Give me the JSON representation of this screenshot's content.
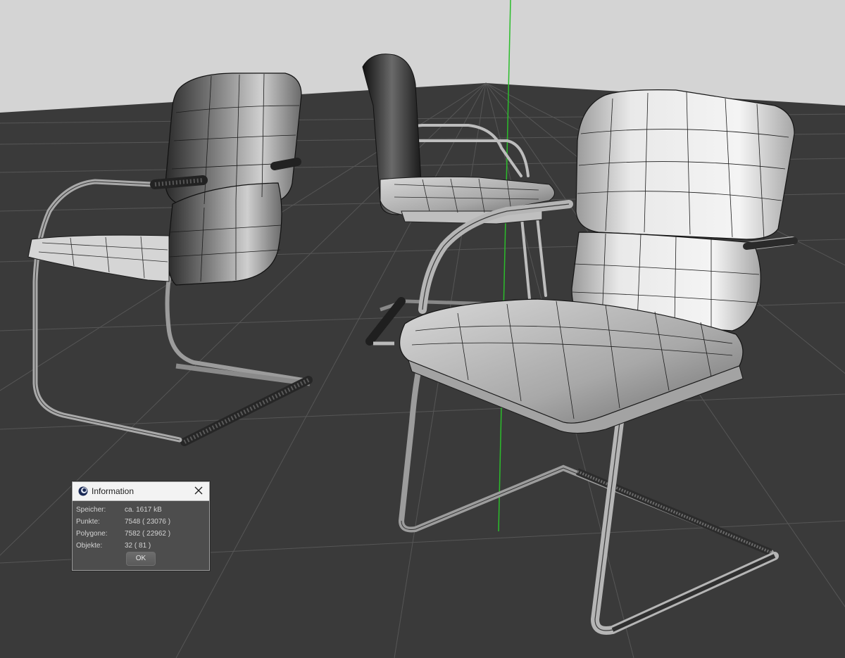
{
  "dialog": {
    "title": "Information",
    "icon": "cinema4d-app-icon",
    "close_icon": "close-icon",
    "rows": [
      {
        "label": "Speicher:",
        "value": "ca. 1617 kB"
      },
      {
        "label": "Punkte:",
        "value": "7548 ( 23076 )"
      },
      {
        "label": "Polygone:",
        "value": "7582 ( 22962 )"
      },
      {
        "label": "Objekte:",
        "value": "32 ( 81 )"
      }
    ],
    "ok_label": "OK"
  },
  "colors": {
    "sky": "#d4d4d4",
    "floor": "#3a3a3a",
    "grid": "#555555",
    "axis_y": "#2bbd2b",
    "dialog_bg": "#4d4d4d",
    "titlebar": "#f3f3f3"
  }
}
